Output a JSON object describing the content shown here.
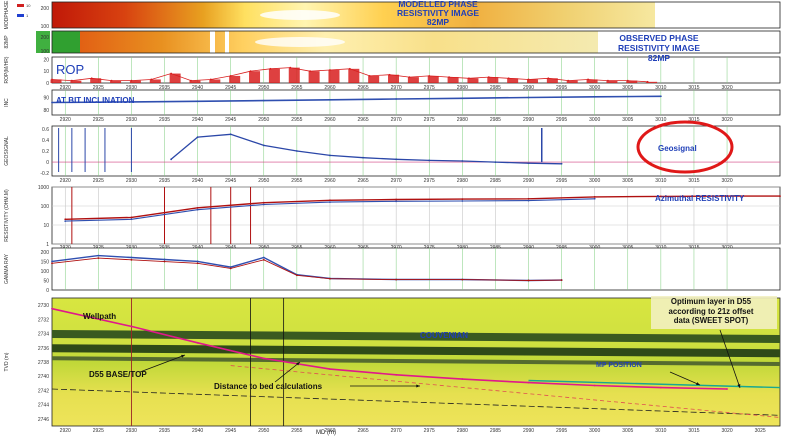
{
  "colors": {
    "rop": "#d81e1e",
    "inclination": "#2f4fb0",
    "geosignal": "#2b47a8",
    "resistivity_red": "#b01010",
    "gamma_blue": "#2f4fb0",
    "grid_green": "#7ccc7c",
    "annotation_blue": "#1f3fb8",
    "ellipse_red": "#e01818",
    "wellpath": "#e0188a",
    "target_line": "#18a890"
  },
  "annotations": {
    "modelled_image": "MODELLED PHASE\nRESISTIVITY IMAGE\n82MP",
    "observed_image": "OBSERVED PHASE\nRESISTIVITY IMAGE\n82MP",
    "rop": "ROP",
    "inclination": "AT BIT INCLINATION",
    "geosignal": "Geosignal",
    "azimuthal": "Azimuthal RESISTIVITY",
    "wellpath": "Wellpath",
    "couvenian": "COUVENIAN",
    "d55": "D55 BASE/TOP",
    "distance": "Distance to bed calculations",
    "optimum": "Optimum layer in D55\naccording to 21z offset\ndata (SWEET SPOT)",
    "target_label": "MP POSITION",
    "x_axis_title": "MD (m)"
  },
  "chart_data": [
    {
      "type": "heatmap",
      "panel": "modelled",
      "ylabel": "MODPHASE",
      "yticks": [
        "200",
        "100"
      ],
      "legend": [
        "10",
        "1"
      ]
    },
    {
      "type": "heatmap",
      "panel": "observed",
      "ylabel": "82MP",
      "yticks": [
        "200",
        "100"
      ]
    },
    {
      "type": "area",
      "panel": "rop",
      "ylabel": "ROP(M/HR)",
      "yticks": [
        "20",
        "10",
        "0"
      ],
      "ylim": [
        0,
        22
      ],
      "x_range": [
        2918,
        3028
      ],
      "xticks": [
        "2920",
        "2925",
        "2930",
        "2935",
        "2940",
        "2945",
        "2950",
        "2955",
        "2960",
        "2965",
        "2970",
        "2975",
        "2980",
        "2985",
        "2990",
        "2995",
        "3000",
        "3005",
        "3010",
        "3015",
        "3020"
      ],
      "x": [
        2918,
        2921,
        2924,
        2927,
        2930,
        2933,
        2936,
        2939,
        2942,
        2945,
        2948,
        2951,
        2954,
        2957,
        2960,
        2963,
        2966,
        2969,
        2972,
        2975,
        2978,
        2981,
        2984,
        2987,
        2990,
        2993,
        2996,
        2999,
        3002,
        3005,
        3008
      ],
      "values": [
        3,
        2,
        4,
        2,
        2,
        3,
        8,
        2,
        3,
        6,
        10,
        12,
        13,
        10,
        11,
        12,
        6,
        7,
        5,
        6,
        5,
        4,
        5,
        4,
        3,
        4,
        2,
        3,
        2,
        2,
        1
      ]
    },
    {
      "type": "line",
      "panel": "inclination",
      "ylabel": "INC",
      "yticks": [
        "90",
        "80"
      ],
      "ylim": [
        76,
        96
      ],
      "x_range": [
        2918,
        3028
      ],
      "xticks": [
        "2920",
        "2925",
        "2930",
        "2935",
        "2940",
        "2945",
        "2950",
        "2955",
        "2960",
        "2965",
        "2970",
        "2975",
        "2980",
        "2985",
        "2990",
        "2995",
        "3000",
        "3005",
        "3010",
        "3015",
        "3020"
      ],
      "x": [
        2918,
        2930,
        2940,
        2950,
        2960,
        2970,
        2980,
        2990,
        3000,
        3010
      ],
      "values": [
        86,
        86.5,
        87,
        87.5,
        88.2,
        88.8,
        89.4,
        90,
        90.6,
        91
      ]
    },
    {
      "type": "line",
      "panel": "geosignal",
      "ylabel": "GEOSIGNAL",
      "yticks": [
        "0.6",
        "0.4",
        "0.2",
        "0",
        "-0.2"
      ],
      "ylim": [
        -0.25,
        0.65
      ],
      "x_range": [
        2918,
        3028
      ],
      "xticks": [
        "2920",
        "2925",
        "2930",
        "2935",
        "2940",
        "2945",
        "2950",
        "2955",
        "2960",
        "2965",
        "2970",
        "2975",
        "2980",
        "2985",
        "2990",
        "2995",
        "3000",
        "3005",
        "3010",
        "3015",
        "3020"
      ],
      "x": [
        2936,
        2940,
        2945,
        2950,
        2955,
        2960,
        2965,
        2970,
        2975,
        2980,
        2985,
        2990,
        2995
      ],
      "values": [
        0.05,
        0.45,
        0.5,
        0.3,
        0.2,
        0.12,
        0.08,
        0.05,
        0.03,
        0.02,
        0.0,
        -0.02,
        -0.03
      ]
    },
    {
      "type": "line",
      "panel": "resistivity",
      "ylabel": "RESISTIVITY (OHM.M)",
      "yticks": [
        "1000",
        "100",
        "10",
        "1"
      ],
      "ylim": [
        1,
        1000
      ],
      "log_scale": true,
      "x_range": [
        2918,
        3028
      ],
      "xticks": [
        "2920",
        "2925",
        "2930",
        "2935",
        "2940",
        "2945",
        "2950",
        "2955",
        "2960",
        "2965",
        "2970",
        "2975",
        "2980",
        "2985",
        "2990",
        "2995",
        "3000",
        "3005",
        "3010",
        "3015",
        "3020"
      ],
      "x": [
        2920,
        2930,
        2940,
        2950,
        2960,
        2970,
        2980,
        2990,
        3000,
        3010,
        3020,
        3028
      ],
      "values": [
        20,
        25,
        80,
        150,
        200,
        220,
        230,
        240,
        300,
        320,
        330,
        330
      ]
    },
    {
      "type": "line",
      "panel": "gamma",
      "ylabel": "GAMMA RAY",
      "yticks": [
        "200",
        "150",
        "100",
        "50",
        "0"
      ],
      "ylim": [
        0,
        220
      ],
      "x_range": [
        2918,
        3028
      ],
      "xticks": [
        "2920",
        "2925",
        "2930",
        "2935",
        "2940",
        "2945",
        "2950",
        "2955",
        "2960",
        "2965",
        "2970",
        "2975",
        "2980",
        "2985",
        "2990",
        "2995",
        "3000",
        "3005",
        "3010",
        "3015",
        "3020"
      ],
      "x": [
        2918,
        2925,
        2930,
        2935,
        2940,
        2945,
        2950,
        2955,
        2960,
        2970,
        2980,
        2990,
        2995
      ],
      "values": [
        150,
        180,
        170,
        160,
        150,
        120,
        170,
        80,
        60,
        55,
        55,
        50,
        52
      ]
    },
    {
      "type": "line",
      "panel": "cross_section",
      "ylabel": "TVD (m)",
      "yticks": [
        "2730",
        "2732",
        "2734",
        "2736",
        "2738",
        "2740",
        "2742",
        "2744",
        "2746"
      ],
      "ylim": [
        2729,
        2747
      ],
      "xlabel": "MD (m)",
      "x_range": [
        2918,
        3028
      ],
      "xticks": [
        "2920",
        "2925",
        "2930",
        "2935",
        "2940",
        "2945",
        "2950",
        "2955",
        "2960",
        "2965",
        "2970",
        "2975",
        "2980",
        "2985",
        "2990",
        "2995",
        "3000",
        "3005",
        "3010",
        "3015",
        "3020",
        "3025"
      ],
      "x": [
        2918,
        2930,
        2940,
        2950,
        2960,
        2970,
        2980,
        2990,
        3000,
        3010,
        3020
      ],
      "values": [
        2730.5,
        2733,
        2735.3,
        2737.5,
        2739,
        2739.8,
        2740.4,
        2740.9,
        2741.3,
        2741.6,
        2741.8
      ]
    }
  ]
}
